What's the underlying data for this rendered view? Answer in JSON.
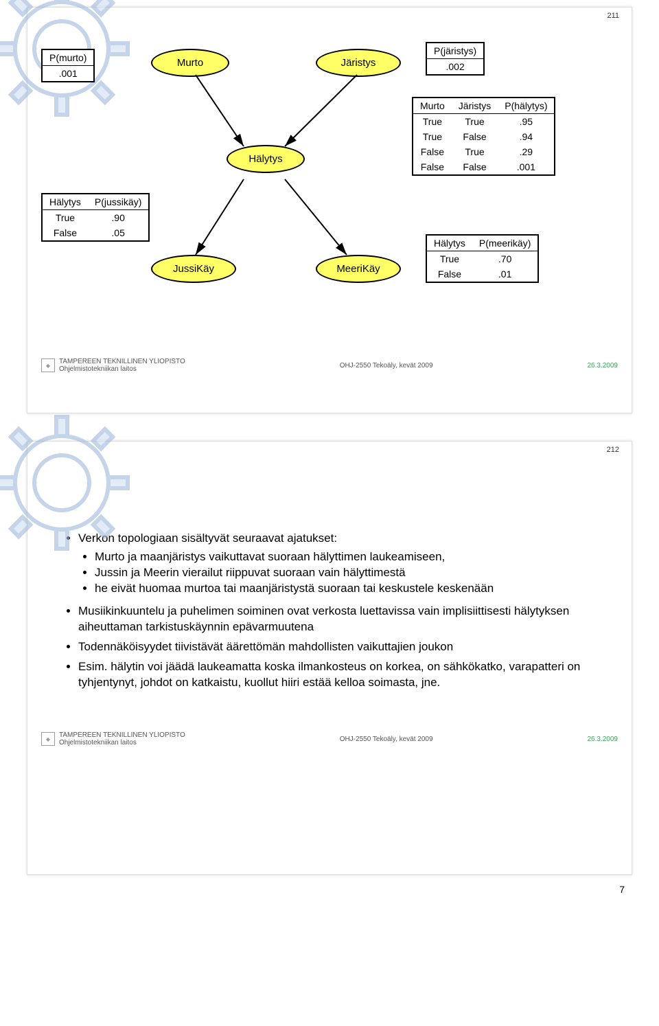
{
  "slide1": {
    "num": "211",
    "nodes": {
      "murto": "Murto",
      "jaristys": "Järistys",
      "halytys": "Hälytys",
      "jussikay": "JussiKäy",
      "meerikay": "MeeriKäy"
    },
    "p_murto": {
      "title": "P(murto)",
      "val": ".001"
    },
    "p_jaristys": {
      "title": "P(järistys)",
      "val": ".002"
    },
    "p_jussikay": {
      "h1": "Hälytys",
      "h2": "P(jussikäy)",
      "r1a": "True",
      "r1b": ".90",
      "r2a": "False",
      "r2b": ".05"
    },
    "p_meerikay": {
      "h1": "Hälytys",
      "h2": "P(meerikäy)",
      "r1a": "True",
      "r1b": ".70",
      "r2a": "False",
      "r2b": ".01"
    },
    "p_halytys": {
      "h1": "Murto",
      "h2": "Järistys",
      "h3": "P(hälytys)",
      "rows": [
        [
          "True",
          "True",
          ".95"
        ],
        [
          "True",
          "False",
          ".94"
        ],
        [
          "False",
          "True",
          ".29"
        ],
        [
          "False",
          "False",
          ".001"
        ]
      ]
    }
  },
  "slide2": {
    "num": "212",
    "bullets": {
      "b1": "Verkon topologiaan sisältyvät seuraavat ajatukset:",
      "s1": "Murto ja maanjäristys vaikuttavat suoraan hälyttimen laukeamiseen,",
      "s2": "Jussin ja Meerin vierailut riippuvat suoraan vain hälyttimestä",
      "s3": "he eivät huomaa murtoa tai maanjäristystä suoraan tai keskustele keskenään",
      "b2": "Musiikinkuuntelu ja puhelimen soiminen ovat verkosta luettavissa vain implisiittisesti hälytyksen aiheuttaman tarkistuskäynnin epävarmuutena",
      "b3": "Todennäköisyydet tiivistävät äärettömän mahdollisten vaikuttajien joukon",
      "b4": "Esim. hälytin voi jäädä laukeamatta koska ilmankosteus on korkea, on sähkökatko, varapatteri on tyhjentynyt, johdot on katkaistu, kuollut hiiri estää kelloa soimasta, jne."
    }
  },
  "footer": {
    "uni1": "TAMPEREEN TEKNILLINEN YLIOPISTO",
    "uni2": "Ohjelmistotekniikan laitos",
    "course": "OHJ-2550 Tekoäly, kevät 2009",
    "date": "26.3.2009"
  },
  "pagenum": "7"
}
